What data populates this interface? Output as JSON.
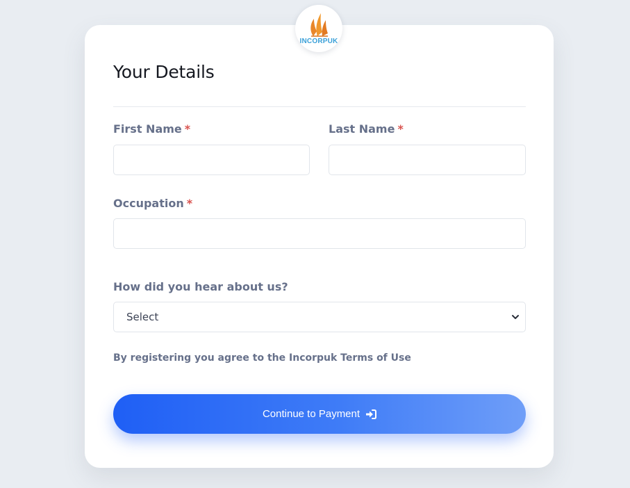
{
  "brand": {
    "logo_text": "INCORPUK",
    "flame_color": "#e8862a",
    "text_color": "#3aa0d8"
  },
  "form": {
    "title": "Your Details",
    "first_name": {
      "label": "First Name",
      "required_mark": "*",
      "value": ""
    },
    "last_name": {
      "label": "Last Name",
      "required_mark": "*",
      "value": ""
    },
    "occupation": {
      "label": "Occupation",
      "required_mark": "*",
      "value": ""
    },
    "referral": {
      "label": "How did you hear about us?",
      "selected": "Select",
      "icon": "chevron-down-icon"
    },
    "terms_text": "By registering you agree to the Incorpuk Terms of Use",
    "submit": {
      "label": "Continue to Payment",
      "icon": "sign-in-icon"
    }
  },
  "colors": {
    "primary": "#1f5ff5",
    "required": "#d9534f",
    "label": "#66708a"
  }
}
